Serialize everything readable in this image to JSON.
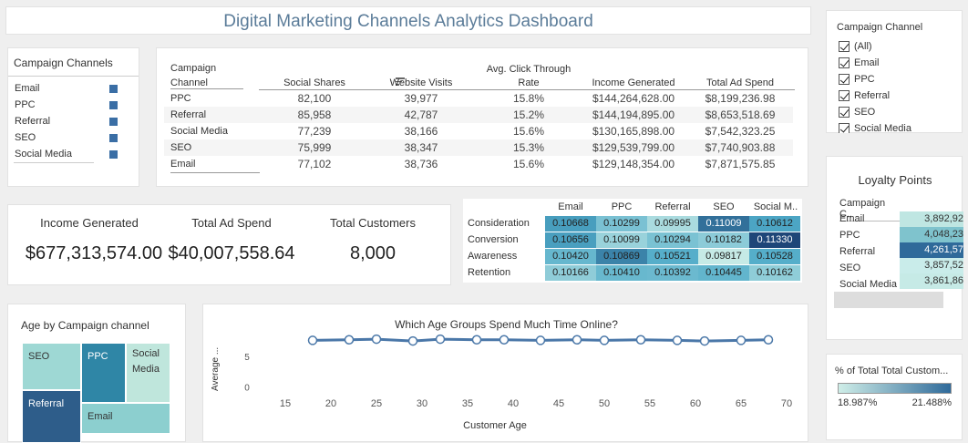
{
  "title": "Digital Marketing Channels Analytics Dashboard",
  "legend": {
    "header": "Campaign Channels",
    "items": [
      "Email",
      "PPC",
      "Referral",
      "SEO",
      "Social Media"
    ]
  },
  "table": {
    "headers": {
      "channel_l1": "Campaign",
      "channel_l2": "Channel",
      "shares": "Social Shares",
      "visits": "Website Visits",
      "ctr_l1": "Avg. Click Through",
      "ctr_l2": "Rate",
      "income": "Income Generated",
      "spend": "Total Ad Spend"
    },
    "rows": [
      {
        "name": "PPC",
        "shares": "82,100",
        "visits": "39,977",
        "ctr": "15.8%",
        "income": "$144,264,628.00",
        "spend": "$8,199,236.98"
      },
      {
        "name": "Referral",
        "shares": "85,958",
        "visits": "42,787",
        "ctr": "15.2%",
        "income": "$144,194,895.00",
        "spend": "$8,653,518.69"
      },
      {
        "name": "Social Media",
        "shares": "77,239",
        "visits": "38,166",
        "ctr": "15.6%",
        "income": "$130,165,898.00",
        "spend": "$7,542,323.25"
      },
      {
        "name": "SEO",
        "shares": "75,999",
        "visits": "38,347",
        "ctr": "15.3%",
        "income": "$129,539,799.00",
        "spend": "$7,740,903.88"
      },
      {
        "name": "Email",
        "shares": "77,102",
        "visits": "38,736",
        "ctr": "15.6%",
        "income": "$129,148,354.00",
        "spend": "$7,871,575.85"
      }
    ]
  },
  "kpis": {
    "income_label": "Income Generated",
    "income_value": "$677,313,574.00",
    "spend_label": "Total Ad Spend",
    "spend_value": "$40,007,558.64",
    "customers_label": "Total Customers",
    "customers_value": "8,000"
  },
  "heatmap": {
    "columns": [
      "Email",
      "PPC",
      "Referral",
      "SEO",
      "Social M.."
    ],
    "rows": [
      {
        "label": "Consideration",
        "values": [
          "0.10668",
          "0.10299",
          "0.09995",
          "0.11009",
          "0.10612"
        ]
      },
      {
        "label": "Conversion",
        "values": [
          "0.10656",
          "0.10099",
          "0.10294",
          "0.10182",
          "0.11330"
        ]
      },
      {
        "label": "Awareness",
        "values": [
          "0.10420",
          "0.10869",
          "0.10521",
          "0.09817",
          "0.10528"
        ]
      },
      {
        "label": "Retention",
        "values": [
          "0.10166",
          "0.10410",
          "0.10392",
          "0.10445",
          "0.10162"
        ]
      }
    ]
  },
  "treemap": {
    "title": "Age by Campaign channel",
    "labels": {
      "seo": "SEO",
      "ppc": "PPC",
      "social1": "Social",
      "social2": "Media",
      "referral": "Referral",
      "email": "Email"
    },
    "colors": {
      "seo": "#9ed8d4",
      "ppc": "#2f86a6",
      "social": "#bfe6dc",
      "referral": "#2e5d8a",
      "email": "#8ccfcf"
    }
  },
  "filter": {
    "title": "Campaign Channel",
    "items": [
      "(All)",
      "Email",
      "PPC",
      "Referral",
      "SEO",
      "Social Media"
    ]
  },
  "loyalty": {
    "title": "Loyalty Points",
    "header": "Campaign C..",
    "rows": [
      {
        "name": "Email",
        "value": "3,892,92",
        "color": "#bfe6e2"
      },
      {
        "name": "PPC",
        "value": "4,048,23",
        "color": "#7fc3cd"
      },
      {
        "name": "Referral",
        "value": "4,261,57",
        "color": "#2f6a9a"
      },
      {
        "name": "SEO",
        "value": "3,857,52",
        "color": "#c9ecea"
      },
      {
        "name": "Social Media",
        "value": "3,861,86",
        "color": "#c6eae6"
      }
    ]
  },
  "gradient_legend": {
    "title": "% of Total Total Custom...",
    "low": "18.987%",
    "high": "21.488%"
  },
  "chart_data": [
    {
      "type": "line",
      "title": "Which Age Groups Spend Much Time Online?",
      "xlabel": "Customer Age",
      "ylabel": "Average ...",
      "x_ticks": [
        "15",
        "20",
        "25",
        "30",
        "35",
        "40",
        "45",
        "50",
        "55",
        "60",
        "65",
        "70"
      ],
      "y_ticks": [
        "0",
        "5"
      ],
      "xlim": [
        12,
        71
      ],
      "ylim": [
        -2,
        9
      ],
      "x": [
        18,
        22,
        25,
        29,
        32,
        36,
        39,
        43,
        47,
        50,
        54,
        58,
        61,
        65,
        68
      ],
      "values": [
        7.6,
        7.7,
        7.8,
        7.5,
        7.8,
        7.7,
        7.7,
        7.6,
        7.7,
        7.6,
        7.7,
        7.6,
        7.5,
        7.6,
        7.7
      ],
      "color": "#4a77a8"
    },
    {
      "type": "heatmap",
      "categories": [
        "Email",
        "PPC",
        "Referral",
        "SEO",
        "Social M.."
      ],
      "rows": [
        "Consideration",
        "Conversion",
        "Awareness",
        "Retention"
      ],
      "values": [
        [
          0.10668,
          0.10299,
          0.09995,
          0.11009,
          0.10612
        ],
        [
          0.10656,
          0.10099,
          0.10294,
          0.10182,
          0.1133
        ],
        [
          0.1042,
          0.10869,
          0.10521,
          0.09817,
          0.10528
        ],
        [
          0.10166,
          0.1041,
          0.10392,
          0.10445,
          0.10162
        ]
      ]
    }
  ]
}
